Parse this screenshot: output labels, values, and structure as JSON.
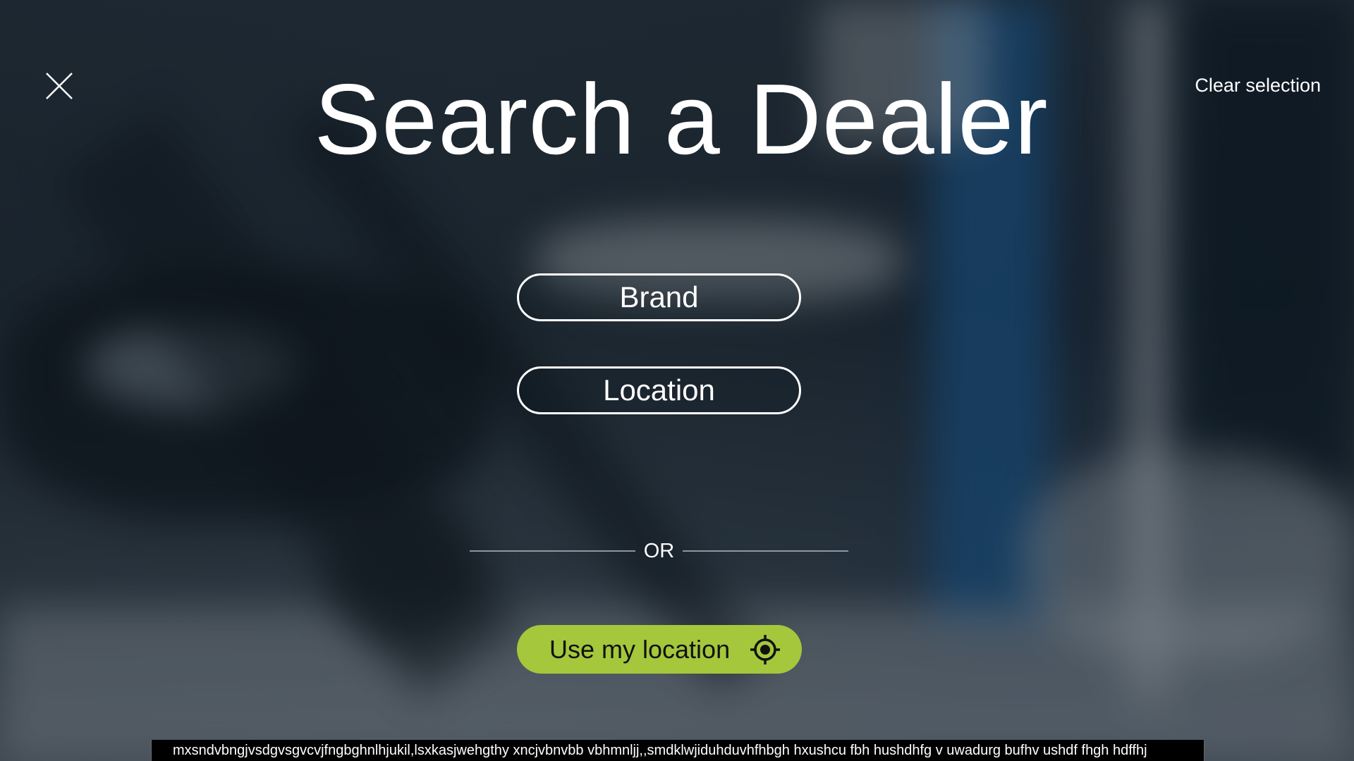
{
  "header": {
    "title": "Search a Dealer",
    "clear_label": "Clear selection"
  },
  "filters": {
    "brand_label": "Brand",
    "location_label": "Location"
  },
  "divider": {
    "text": "OR"
  },
  "geolocate": {
    "label": "Use my location",
    "icon": "crosshair-target-icon",
    "color": "#a4c73c"
  },
  "ticker": {
    "text": "mxsndvbngjvsdgvsgvcvjfngbghnlhjukil,lsxkasjwehgthy xncjvbnvbb vbhmnljj,,smdklwjiduhduvhfhbgh hxushcu fbh hushdhfg v uwadurg bufhv ushdf fhgh hdffhj"
  },
  "icons": {
    "close": "close-icon"
  },
  "colors": {
    "text": "#ffffff",
    "accent": "#a4c73c",
    "ticker_bg": "#000000"
  }
}
